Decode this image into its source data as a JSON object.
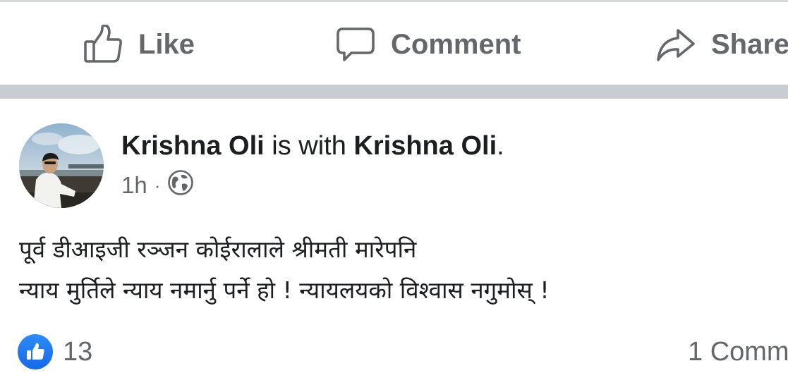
{
  "actions": {
    "like_label": "Like",
    "comment_label": "Comment",
    "share_label": "Share"
  },
  "post": {
    "author": "Krishna Oli",
    "with_text": "is with",
    "tagged": "Krishna Oli",
    "period": ".",
    "time": "1h",
    "dot": "·",
    "privacy_icon": "globe-icon",
    "text_lines": [
      "पूर्व डीआइजी रञ्जन कोईरालाले श्रीमती मारेपनि",
      "न्याय मुर्तिले न्याय नमार्नु पर्ने हो ! न्यायलयको विश्वास नगुमोस् !"
    ],
    "reaction_count": "13",
    "comments_label": "1 Comm"
  },
  "colors": {
    "secondary_text": "#65676b",
    "primary_text": "#1c1e21",
    "like_blue": "#1877f2",
    "separator": "#c9ccd1"
  }
}
